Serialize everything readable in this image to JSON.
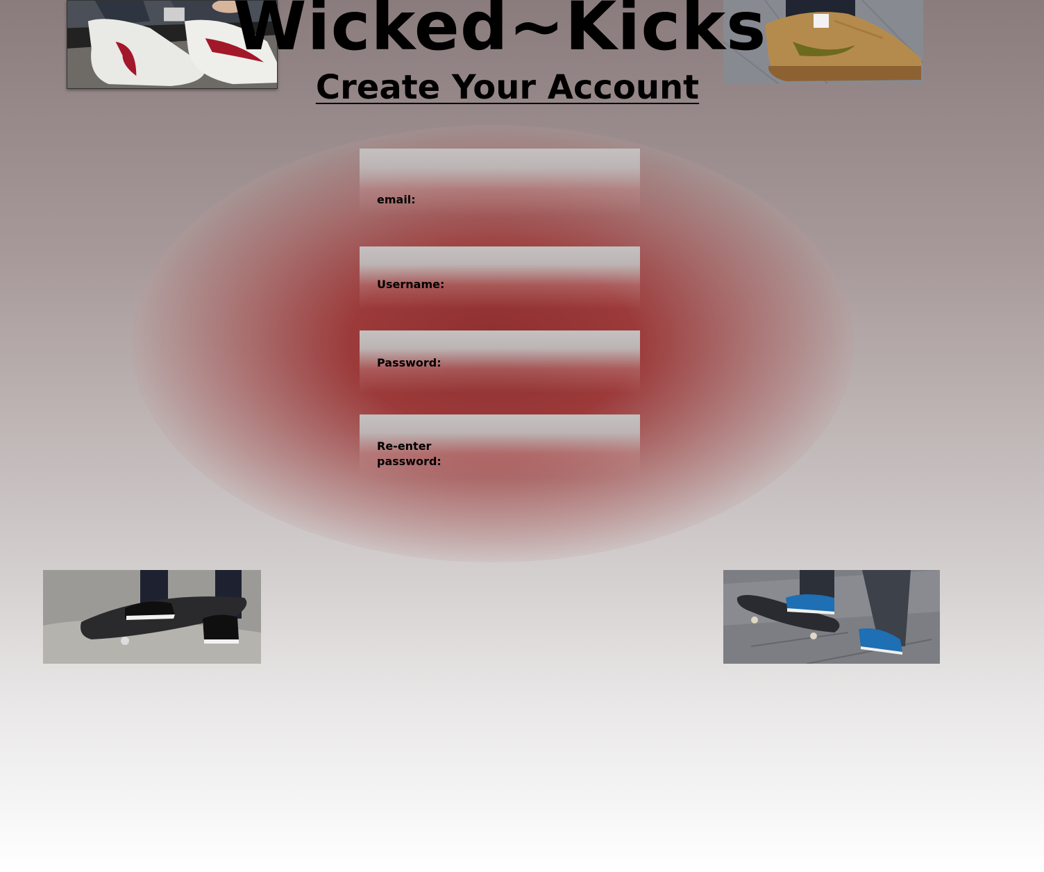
{
  "header": {
    "site_title": "Wicked~Kicks",
    "page_subtitle": "Create Your Account"
  },
  "form": {
    "email_label": "email:",
    "username_label": "Username:",
    "password_label": "Password:",
    "repassword_label": "Re-enter password:"
  },
  "colors": {
    "title_text": "#000000",
    "glow_red": "#8e2f2f",
    "field_gray": "#c5c0c0"
  }
}
